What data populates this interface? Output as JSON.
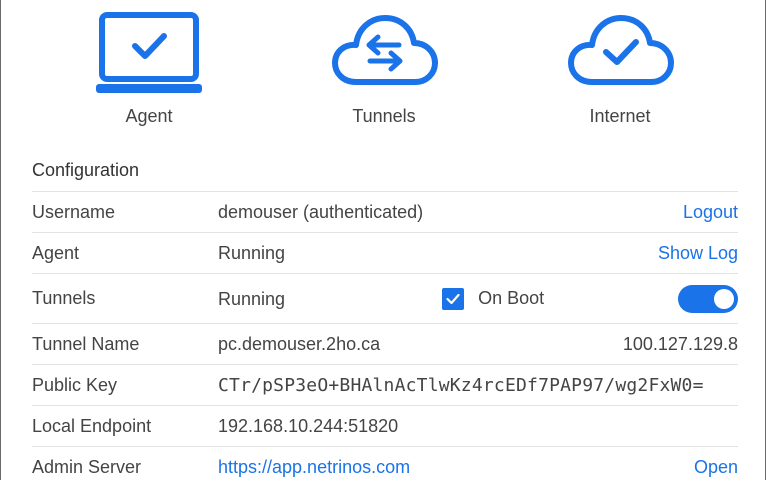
{
  "status": {
    "agent": {
      "label": "Agent",
      "icon": "laptop-check-icon"
    },
    "tunnels": {
      "label": "Tunnels",
      "icon": "cloud-arrows-icon"
    },
    "internet": {
      "label": "Internet",
      "icon": "cloud-check-icon"
    },
    "accent": "#1a73e8"
  },
  "config": {
    "title": "Configuration",
    "username": {
      "label": "Username",
      "value": "demouser (authenticated)",
      "action": "Logout"
    },
    "agent": {
      "label": "Agent",
      "value": "Running",
      "action": "Show Log"
    },
    "tunnels": {
      "label": "Tunnels",
      "value": "Running",
      "on_boot_label": "On Boot",
      "on_boot_checked": true,
      "toggle_on": true
    },
    "tunnel_name": {
      "label": "Tunnel Name",
      "value": "pc.demouser.2ho.ca",
      "ip": "100.127.129.8"
    },
    "public_key": {
      "label": "Public Key",
      "value": "CTr/pSP3eO+BHAlnAcTlwKz4rcEDf7PAP97/wg2FxW0="
    },
    "local_endpoint": {
      "label": "Local Endpoint",
      "value": "192.168.10.244:51820"
    },
    "admin_server": {
      "label": "Admin Server",
      "value": "https://app.netrinos.com",
      "action": "Open"
    }
  }
}
